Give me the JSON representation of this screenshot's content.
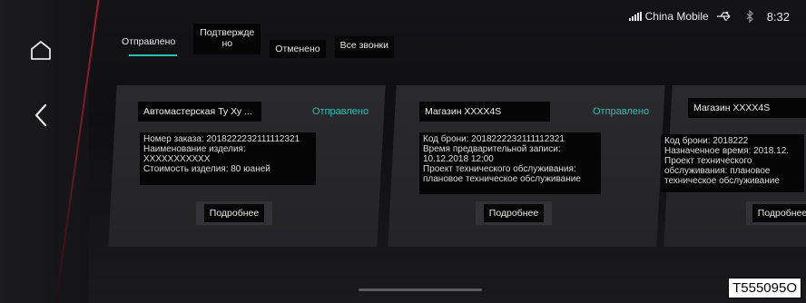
{
  "status": {
    "carrier": "China Mobile",
    "time": "8:32"
  },
  "tabs": [
    {
      "label": "Отправлено",
      "active": true
    },
    {
      "label": "Подтвержде\nно",
      "active": false
    },
    {
      "label": "Отменено",
      "active": false
    },
    {
      "label": "Все звонки",
      "active": false
    }
  ],
  "cards": [
    {
      "name": "Автомастерская Ту Ху ...",
      "status": "Отправлено",
      "lines": [
        "Номер заказа: 2018222232111112321",
        "Наименование изделия:",
        "XXXXXXXXXXX",
        "Стоимость изделия: 80 юаней"
      ],
      "button": "Подробнее"
    },
    {
      "name": "Магазин XXXX4S",
      "status": "Отправлено",
      "lines": [
        "Код брони: 2018222232111112321",
        "Время предварительной записи:",
        "10.12.2018 12:00",
        "Проект  технического  обслуживания:",
        "плановое техническое обслуживание"
      ],
      "button": "Подробнее"
    },
    {
      "name": "Магазин XXXX4S",
      "status": "",
      "lines": [
        "Код брони: 2018222",
        "Назначенное время: 2018.12.",
        "Проект                технического",
        "обслуживания:             плановое",
        "техническое обслуживание"
      ],
      "button": "Подробнее"
    }
  ],
  "watermark": "T555095O",
  "colors": {
    "accent": "#2bbfb8",
    "rail_line": "#c01d3a"
  }
}
